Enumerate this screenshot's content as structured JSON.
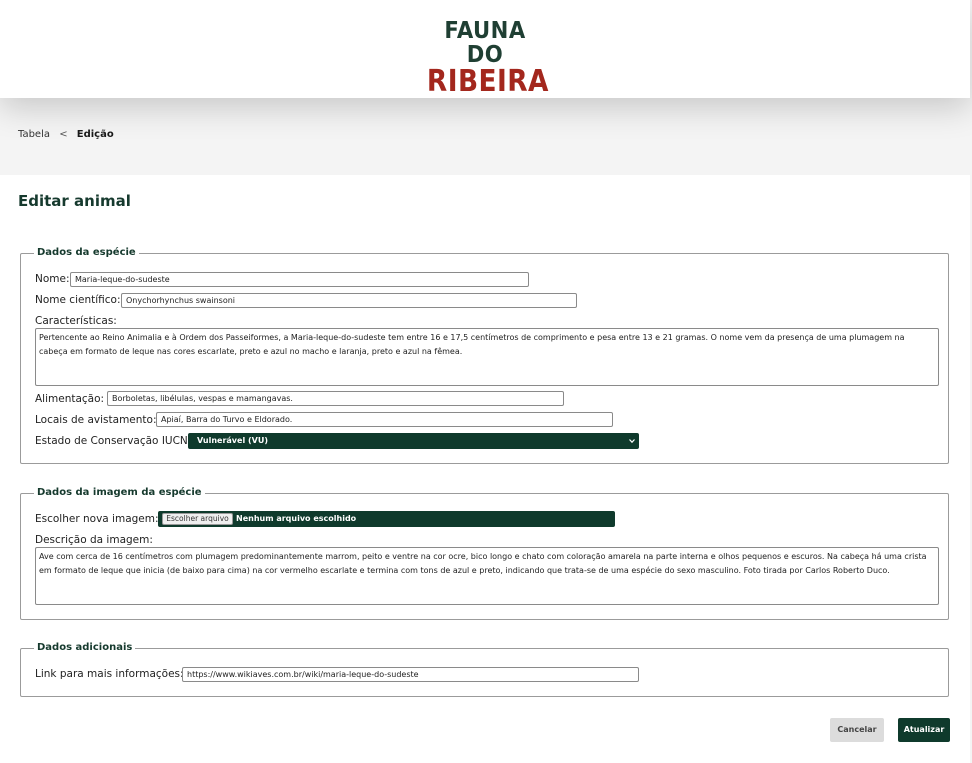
{
  "logo": {
    "line1": "FAUNA DO",
    "line2": "RIBEIRA"
  },
  "breadcrumb": {
    "parent": "Tabela",
    "separator": "<",
    "current": "Edição"
  },
  "page_title": "Editar animal",
  "species_section": {
    "legend": "Dados da espécie",
    "name_label": "Nome:",
    "name_value": "Maria-leque-do-sudeste",
    "scientific_label": "Nome científico:",
    "scientific_value": "Onychorhynchus swainsoni",
    "characteristics_label": "Características:",
    "characteristics_value": "Pertencente ao Reino Animalia e à Ordem dos Passeiformes, a Maria-leque-do-sudeste tem entre 16 e 17,5 centímetros de comprimento e pesa entre 13 e 21 gramas. O nome vem da presença de uma plumagem na cabeça em formato de leque nas cores escarlate, preto e azul no macho e laranja, preto e azul na fêmea.",
    "diet_label": "Alimentação:",
    "diet_value": "Borboletas, libélulas, vespas e mamangavas.",
    "sighting_label": "Locais de avistamento:",
    "sighting_value": "Apiaí, Barra do Turvo e Eldorado.",
    "conservation_label": "Estado de Conservação IUCN:",
    "conservation_value": "Vulnerável (VU)"
  },
  "image_section": {
    "legend": "Dados da imagem da espécie",
    "choose_label": "Escolher nova imagem:",
    "choose_button": "Escolher arquivo",
    "file_status": "Nenhum arquivo escolhido",
    "description_label": "Descrição da imagem:",
    "description_value": "Ave com cerca de 16 centímetros com plumagem predominantemente marrom,  peito e ventre na cor ocre, bico longo e chato com coloração amarela na parte interna e olhos pequenos e escuros. Na cabeça há uma crista em formato de leque que inicia (de baixo para cima) na cor vermelho escarlate e termina com tons de azul e preto, indicando que trata-se de uma espécie do sexo masculino. Foto tirada por Carlos Roberto Duco."
  },
  "additional_section": {
    "legend": "Dados adicionais",
    "link_label": "Link para mais informações:",
    "link_value": "https://www.wikiaves.com.br/wiki/maria-leque-do-sudeste"
  },
  "actions": {
    "cancel": "Cancelar",
    "update": "Atualizar"
  },
  "icons": {
    "select_arrow": "chevron-down-icon"
  },
  "colors": {
    "brand_green": "#0f3a2c",
    "brand_red": "#a3271d"
  }
}
